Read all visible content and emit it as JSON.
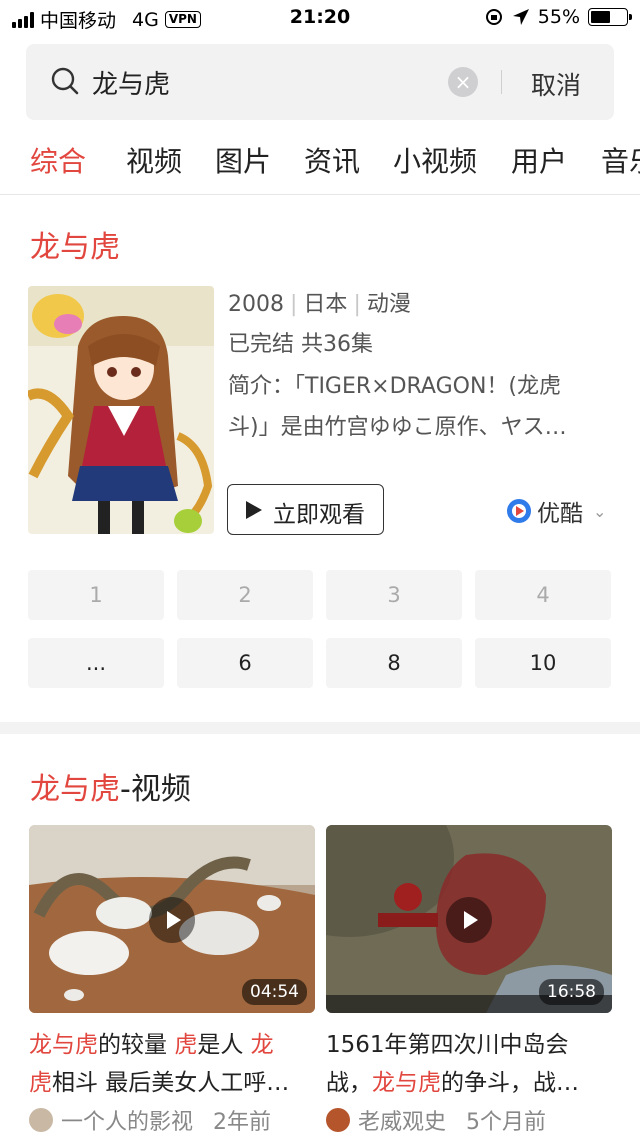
{
  "status_bar": {
    "carrier": "中国移动",
    "network": "4G",
    "vpn": "VPN",
    "time": "21:20",
    "battery": "55%"
  },
  "search": {
    "query": "龙与虎",
    "cancel": "取消"
  },
  "tabs": [
    "综合",
    "视频",
    "图片",
    "资讯",
    "小视频",
    "用户",
    "音乐"
  ],
  "card1": {
    "title": "龙与虎",
    "year": "2008",
    "country": "日本",
    "category": "动漫",
    "status": "已完结 共36集",
    "desc_line1": "简介：「TIGER×DRAGON！(龙虎",
    "desc_line2": "斗)」是由竹宫ゆゆこ原作、ヤス…",
    "watch_label": "立即观看",
    "source": "优酷",
    "episodes_row1": [
      "1",
      "2",
      "3",
      "4"
    ],
    "episodes_row2": [
      "...",
      "6",
      "8",
      "10"
    ]
  },
  "card2": {
    "title_hl": "龙与虎",
    "title_rest": "-视频",
    "videos": [
      {
        "duration": "04:54",
        "t1_hl": "龙与虎",
        "t1a": "的较量 ",
        "t1_hl2": "虎",
        "t1b": "是人 ",
        "t1_hl3": "龙",
        "t2_hl": "虎",
        "t2": "相斗 最后美女人工呼…",
        "author": "一个人的影视",
        "age": "2年前"
      },
      {
        "duration": "16:58",
        "t1": "1561年第四次川中岛会",
        "t2a": "战，",
        "t2_hl": "龙与虎",
        "t2b": "的争斗，战…",
        "author": "老威观史",
        "age": "5个月前"
      }
    ]
  }
}
